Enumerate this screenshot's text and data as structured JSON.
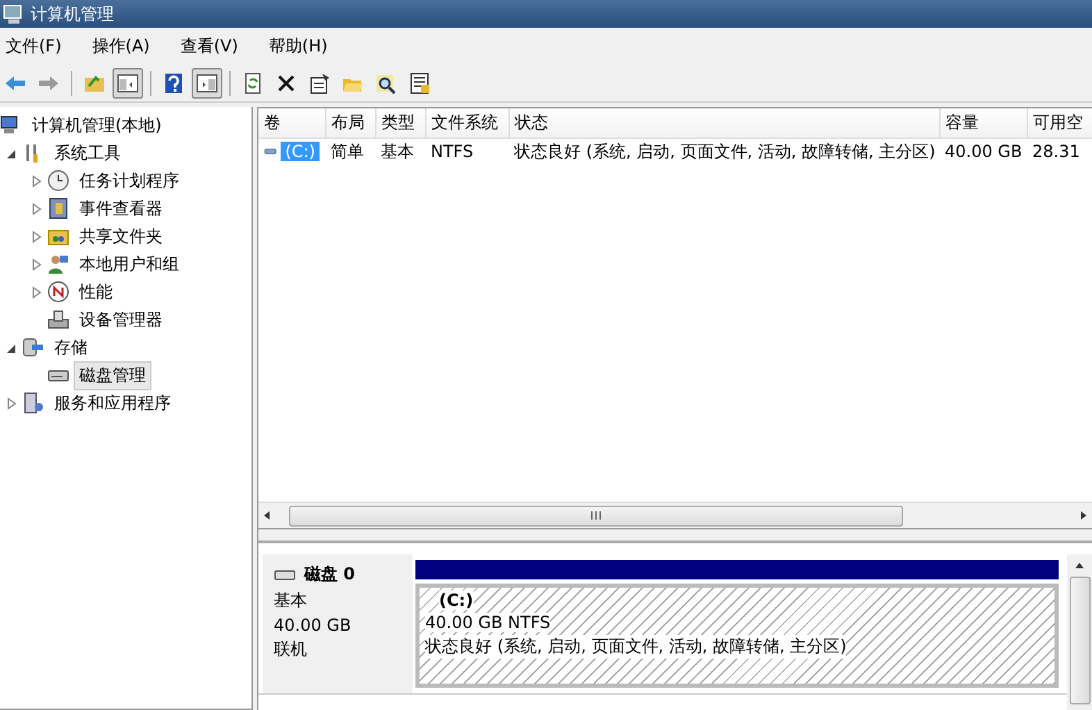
{
  "window": {
    "title": "计算机管理"
  },
  "menu": [
    {
      "label": "文件(F)"
    },
    {
      "label": "操作(A)"
    },
    {
      "label": "查看(V)"
    },
    {
      "label": "帮助(H)"
    }
  ],
  "toolbar": [
    {
      "kind": "back",
      "pressed": false
    },
    {
      "kind": "forward",
      "pressed": false
    },
    {
      "kind": "separator"
    },
    {
      "kind": "up",
      "pressed": false
    },
    {
      "kind": "pane",
      "pressed": true
    },
    {
      "kind": "separator"
    },
    {
      "kind": "help",
      "pressed": false
    },
    {
      "kind": "pane2",
      "pressed": true
    },
    {
      "kind": "separator"
    },
    {
      "kind": "refresh",
      "pressed": false
    },
    {
      "kind": "delete",
      "pressed": false
    },
    {
      "kind": "properties",
      "pressed": false
    },
    {
      "kind": "open",
      "pressed": false
    },
    {
      "kind": "search",
      "pressed": false
    },
    {
      "kind": "export",
      "pressed": false
    }
  ],
  "tree": [
    {
      "label": "计算机管理(本地)",
      "kind": "computer",
      "selected": false,
      "children": [
        {
          "label": "系统工具",
          "kind": "tools",
          "expanded": true,
          "selected": false,
          "children": [
            {
              "label": "任务计划程序",
              "kind": "clock",
              "expanded": false,
              "selected": false
            },
            {
              "label": "事件查看器",
              "kind": "log",
              "expanded": false,
              "selected": false
            },
            {
              "label": "共享文件夹",
              "kind": "folder",
              "expanded": false,
              "selected": false
            },
            {
              "label": "本地用户和组",
              "kind": "users",
              "expanded": false,
              "selected": false
            },
            {
              "label": "性能",
              "kind": "gauge",
              "expanded": false,
              "selected": false
            },
            {
              "label": "设备管理器",
              "kind": "device",
              "selected": false
            }
          ]
        },
        {
          "label": "存储",
          "kind": "storage",
          "expanded": true,
          "selected": false,
          "children": [
            {
              "label": "磁盘管理",
              "kind": "disk",
              "selected": true
            }
          ]
        },
        {
          "label": "服务和应用程序",
          "kind": "services",
          "expanded": false,
          "selected": false
        }
      ]
    }
  ],
  "volumes": {
    "columns": [
      "卷",
      "布局",
      "类型",
      "文件系统",
      "状态",
      "容量",
      "可用空"
    ],
    "rows": [
      {
        "selected": true,
        "cells": [
          "(C:)",
          "简单",
          "基本",
          "NTFS",
          "状态良好 (系统, 启动, 页面文件, 活动, 故障转储, 主分区)",
          "40.00 GB",
          "28.31"
        ]
      }
    ]
  },
  "disks": [
    {
      "name": "磁盘 0",
      "type": "基本",
      "size": "40.00 GB",
      "status": "联机",
      "partitions": [
        {
          "label": "(C:)",
          "size": "40.00 GB NTFS",
          "status": "状态良好 (系统, 启动, 页面文件, 活动, 故障转储, 主分区)"
        }
      ]
    }
  ]
}
